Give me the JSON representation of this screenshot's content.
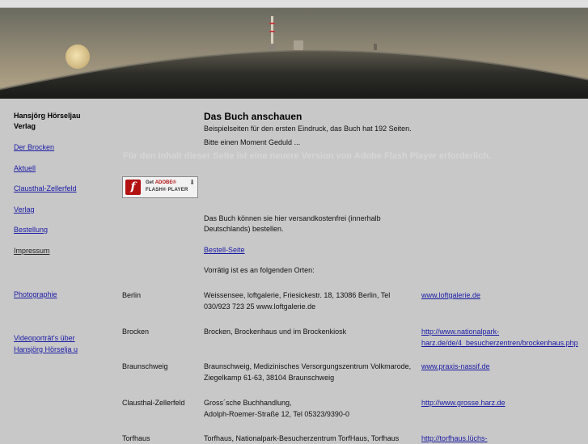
{
  "sidebar": {
    "brand_line1": "Hansjörg Hörseljau",
    "brand_line2": "Verlag",
    "links": [
      "Der Brocken",
      "Aktuell",
      "Clausthal-Zellerfeld",
      "Verlag",
      "Bestellung",
      "Impressum",
      "Photographie",
      "Videoporträt's über",
      "Hansjörg Hörselja u"
    ]
  },
  "main": {
    "title": "Das Buch anschauen",
    "intro1": "Beispielseiten für den ersten Eindruck, das Buch hat 192 Seiten.",
    "intro2": "Bitte einen Moment Geduld ...",
    "flash_notice": "Für den Inhalt dieser Seite ist eine neuere Version von Adobe Flash Player erforderlich.",
    "flash_button": {
      "line1_prefix": "Get",
      "line1_brand": "ADOBE®",
      "line2": "FLASH® PLAYER",
      "logo": "f"
    },
    "order1": "Das Buch können sie hier versandkostenfrei (innerhalb",
    "order2": "Deutschlands) bestellen.",
    "order_link": "Bestell-Seite",
    "stock_intro": "Vorrätig ist es an folgenden Orten:",
    "locations": [
      {
        "city": "Berlin",
        "desc1": "Weissensee, loftgalerie, Friesickestr. 18, 13086 Berlin, Tel",
        "desc2": "030/923 723 25 www.loftgalerie.de",
        "link1": "www.loftgalerie.de",
        "link2": ""
      },
      {
        "city": "Brocken",
        "desc1": "Brocken, Brockenhaus und im Brockenkiosk",
        "desc2": "",
        "link1": "http://www.nationalpark-",
        "link2": "harz.de/de/4_besucherzentren/brockenhaus.php"
      },
      {
        "city": "Braunschweig",
        "desc1": "Braunschweig, Medizinisches Versorgungszentrum Volkmarode,",
        "desc2": "Ziegelkamp 61-63, 38104 Braunschweig",
        "link1": "www.praxis-nassif.de",
        "link2": ""
      },
      {
        "city": "Clausthal-Zellerfeld",
        "desc1": "Gross´sche Buchhandlung,",
        "desc2": "Adolph-Roemer-Straße 12, Tel 05323/9390-0",
        "link1": "http://www.grosse.harz.de",
        "link2": ""
      },
      {
        "city": "Torfhaus",
        "desc1": "Torfhaus, Nationalpark-Besucherzentrum TorfHaus, Torfhaus",
        "desc2": "",
        "link1": "http://torfhaus.lüchs-",
        "link2": ""
      }
    ]
  }
}
